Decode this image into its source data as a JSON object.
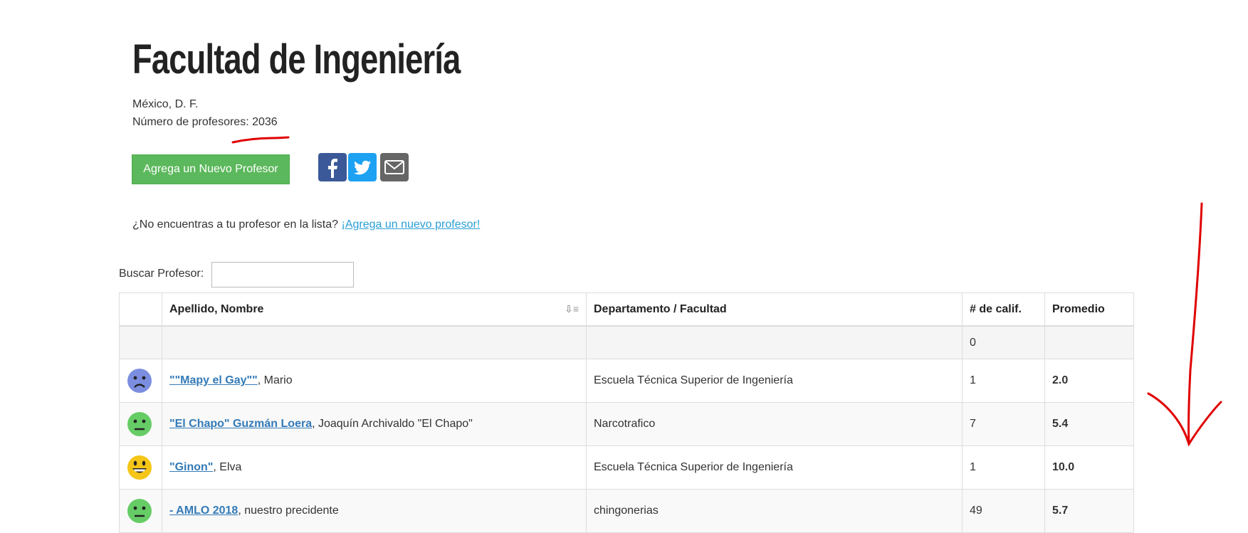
{
  "header": {
    "title": "Facultad de Ingeniería",
    "location": "México, D. F.",
    "professor_count_label": "Número de profesores: 2036"
  },
  "actions": {
    "add_professor_button": "Agrega un Nuevo Profesor",
    "share_icons": [
      "facebook-icon",
      "twitter-icon",
      "email-icon"
    ]
  },
  "not_found": {
    "text": "¿No encuentras a tu profesor en la lista? ",
    "link": "¡Agrega un nuevo profesor!"
  },
  "search": {
    "label": "Buscar Profesor:",
    "value": ""
  },
  "table": {
    "headers": [
      "",
      "Apellido, Nombre",
      "Departamento / Facultad",
      "# de calif.",
      "Promedio"
    ],
    "empty_row_count": "0",
    "rows": [
      {
        "face": "sad",
        "face_color": "#7b8ee0",
        "name_link": "\"\"Mapy el Gay\"\"",
        "name_rest": ", Mario",
        "dept": "Escuela Técnica Superior de Ingeniería",
        "count": "1",
        "avg": "2.0"
      },
      {
        "face": "neutral",
        "face_color": "#66cc66",
        "name_link": "\"El Chapo\" Guzmán Loera",
        "name_rest": ", Joaquín Archivaldo \"El Chapo\"",
        "dept": "Narcotrafico",
        "count": "7",
        "avg": "5.4"
      },
      {
        "face": "happy",
        "face_color": "#f5c518",
        "name_link": "\"Ginon\"",
        "name_rest": ", Elva",
        "dept": "Escuela Técnica Superior de Ingeniería",
        "count": "1",
        "avg": "10.0"
      },
      {
        "face": "neutral",
        "face_color": "#66cc66",
        "name_link": "- AMLO 2018",
        "name_rest": ", nuestro precidente",
        "dept": "chingonerias",
        "count": "49",
        "avg": "5.7"
      }
    ]
  },
  "colors": {
    "button_green": "#5cb85c",
    "link_blue": "#337ab7",
    "annotation_red": "#e00000"
  }
}
